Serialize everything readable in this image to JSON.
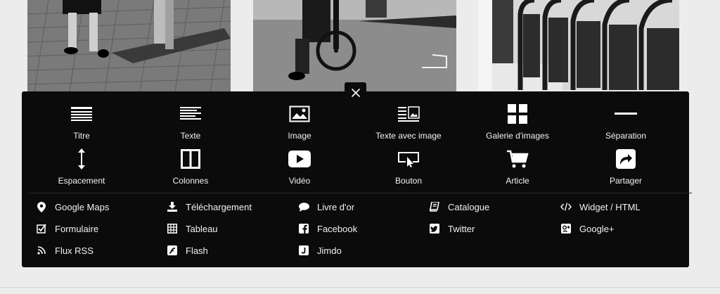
{
  "photos": [
    {
      "icon": "photo-pedestrians"
    },
    {
      "icon": "photo-cyclist"
    },
    {
      "icon": "photo-bus-seats"
    }
  ],
  "panel": {
    "close_icon": "close-icon",
    "tiles": [
      {
        "label": "Titre",
        "icon": "title-icon"
      },
      {
        "label": "Texte",
        "icon": "text-icon"
      },
      {
        "label": "Image",
        "icon": "image-icon"
      },
      {
        "label": "Texte avec image",
        "icon": "text-with-image-icon"
      },
      {
        "label": "Galerie d'images",
        "icon": "gallery-icon"
      },
      {
        "label": "Séparation",
        "icon": "separator-icon"
      },
      {
        "label": "Espacement",
        "icon": "spacing-icon"
      },
      {
        "label": "Colonnes",
        "icon": "columns-icon"
      },
      {
        "label": "Vidéo",
        "icon": "video-icon"
      },
      {
        "label": "Bouton",
        "icon": "button-icon"
      },
      {
        "label": "Article",
        "icon": "cart-icon"
      },
      {
        "label": "Partager",
        "icon": "share-icon"
      }
    ],
    "links": [
      {
        "label": "Google Maps",
        "icon": "map-pin-icon"
      },
      {
        "label": "Téléchargement",
        "icon": "download-icon"
      },
      {
        "label": "Livre d'or",
        "icon": "speech-bubble-icon"
      },
      {
        "label": "Catalogue",
        "icon": "book-icon"
      },
      {
        "label": "Widget / HTML",
        "icon": "code-icon"
      },
      {
        "label": "Formulaire",
        "icon": "form-checkbox-icon"
      },
      {
        "label": "Tableau",
        "icon": "table-icon"
      },
      {
        "label": "Facebook",
        "icon": "facebook-icon"
      },
      {
        "label": "Twitter",
        "icon": "twitter-icon"
      },
      {
        "label": "Google+",
        "icon": "google-plus-icon"
      },
      {
        "label": "Flux RSS",
        "icon": "rss-icon"
      },
      {
        "label": "Flash",
        "icon": "flash-icon"
      },
      {
        "label": "Jimdo",
        "icon": "jimdo-icon"
      }
    ]
  }
}
